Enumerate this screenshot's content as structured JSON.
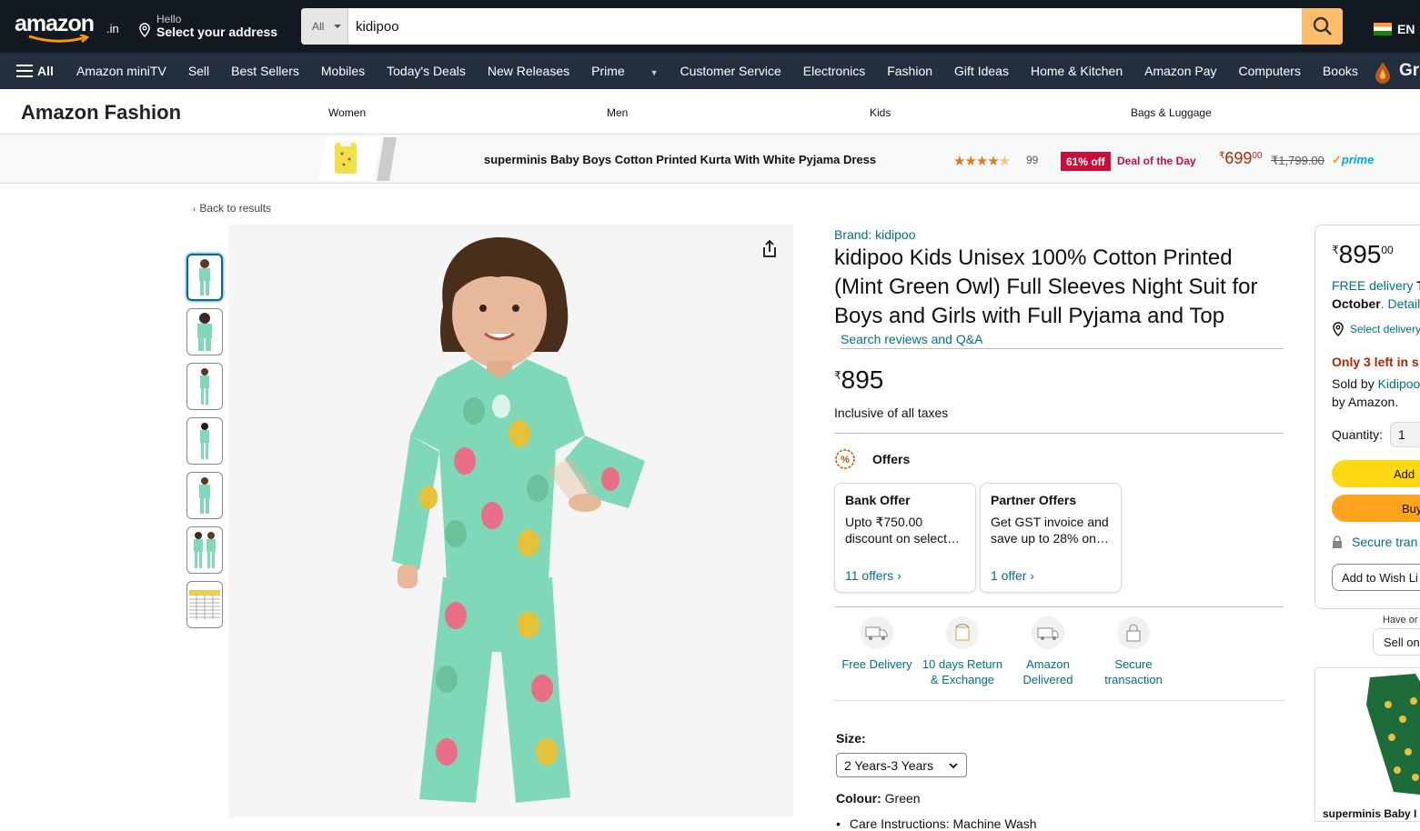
{
  "header": {
    "logo_text": "amazon",
    "logo_suffix": ".in",
    "address_line1": "Hello",
    "address_line2": "Select your address",
    "search_category": "All",
    "search_value": "kidipoo",
    "language": "EN"
  },
  "nav": {
    "all_label": "All",
    "items": [
      "Amazon miniTV",
      "Sell",
      "Best Sellers",
      "Mobiles",
      "Today's Deals",
      "New Releases",
      "Prime",
      "Customer Service",
      "Electronics",
      "Fashion",
      "Gift Ideas",
      "Home & Kitchen",
      "Amazon Pay",
      "Computers",
      "Books"
    ],
    "promo_text": "Gr"
  },
  "fashion_nav": {
    "title": "Amazon Fashion",
    "categories": [
      "Women",
      "Men",
      "Kids",
      "Bags & Luggage"
    ]
  },
  "deal_bar": {
    "title": "superminis Baby Boys Cotton Printed Kurta With White Pyjama Dress",
    "rating": 4.5,
    "rating_count": "99",
    "discount": "61% off",
    "deal_label": "Deal of the Day",
    "price_symbol": "₹",
    "price": "699",
    "price_fraction": "00",
    "mrp": "₹1,799.00",
    "prime": "prime"
  },
  "back_link": "Back to results",
  "product": {
    "brand": "Brand: kidipoo",
    "title": "kidipoo Kids Unisex 100% Cotton Printed (Mint Green Owl) Full Sleeves Night Suit for Boys and Girls with Full Pyjama and Top",
    "search_reviews": "Search reviews and Q&A",
    "price_symbol": "₹",
    "price": "895",
    "tax_note": "Inclusive of all taxes",
    "offers_heading": "Offers",
    "offers": [
      {
        "title": "Bank Offer",
        "body": "Upto ₹750.00 discount on select…",
        "link": "11 offers ›"
      },
      {
        "title": "Partner Offers",
        "body": "Get GST invoice and save up to 28% on…",
        "link": "1 offer ›"
      }
    ],
    "features": [
      {
        "icon": "truck-icon",
        "label": "Free Delivery"
      },
      {
        "icon": "return-box-icon",
        "label": "10 days Return & Exchange"
      },
      {
        "icon": "delivery-van-icon",
        "label": "Amazon Delivered"
      },
      {
        "icon": "lock-icon",
        "label": "Secure transaction"
      }
    ],
    "size_label": "Size:",
    "size_value": "2 Years-3 Years",
    "colour_label": "Colour:",
    "colour_value": "Green",
    "care_instructions": "Care Instructions: Machine Wash"
  },
  "buybox": {
    "price_symbol": "₹",
    "price": "895",
    "price_fraction": "00",
    "delivery_link": "FREE delivery",
    "delivery_tail": " T",
    "delivery_date": "October",
    "details_link": ". Detail",
    "select_delivery": "Select delivery",
    "stock": "Only 3 left in s",
    "sold_prefix": "Sold by ",
    "sold_by": "Kidipoo",
    "fulfilled": "by Amazon.",
    "quantity_label": "Quantity:",
    "quantity_value": "1",
    "add_button": "Add",
    "buy_button": "Buy",
    "secure": "Secure tran",
    "wishlist": "Add to Wish Li",
    "have_one": "Have or",
    "sell_on": "Sell on",
    "ad_title": "superminis Baby I"
  },
  "colors": {
    "header_bg": "#131921",
    "nav_bg": "#232f3e",
    "search_button": "#febd69",
    "link": "#007185",
    "deal_red": "#cc0c39",
    "price_red": "#b12704",
    "add_cart": "#ffd814",
    "buy_now": "#ffa41c"
  }
}
